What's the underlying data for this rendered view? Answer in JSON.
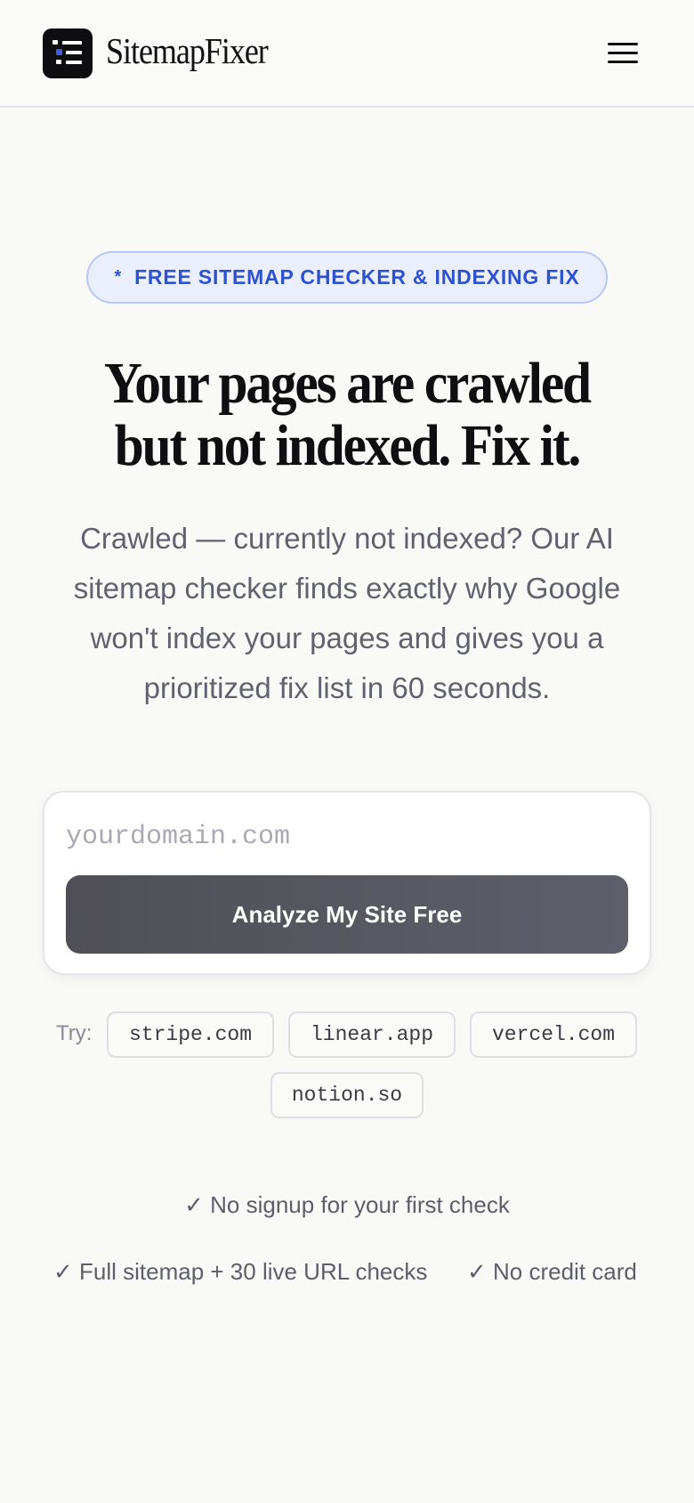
{
  "header": {
    "brand": "SitemapFixer",
    "logo_icon": "list-icon",
    "menu_icon": "hamburger-menu-icon"
  },
  "hero": {
    "badge_star": "*",
    "badge_text": "FREE SITEMAP CHECKER & INDEXING FIX",
    "headline_line1": "Your pages are crawled",
    "headline_line2": "but not indexed. Fix it.",
    "subtitle": "Crawled — currently not indexed? Our AI sitemap checker finds exactly why Google won't index your pages and gives you a prioritized fix list in 60 seconds."
  },
  "form": {
    "input_placeholder": "yourdomain.com",
    "input_value": "",
    "button_label": "Analyze My Site Free"
  },
  "examples": {
    "label": "Try:",
    "items": [
      "stripe.com",
      "linear.app",
      "vercel.com",
      "notion.so"
    ]
  },
  "checks": [
    "✓ No signup for your first check",
    "✓ Full sitemap + 30 live URL checks",
    "✓ No credit card"
  ],
  "colors": {
    "accent": "#2d52d0",
    "badge_bg": "#ebeffd",
    "button_bg": "#56565f",
    "text_muted": "#62626e"
  }
}
